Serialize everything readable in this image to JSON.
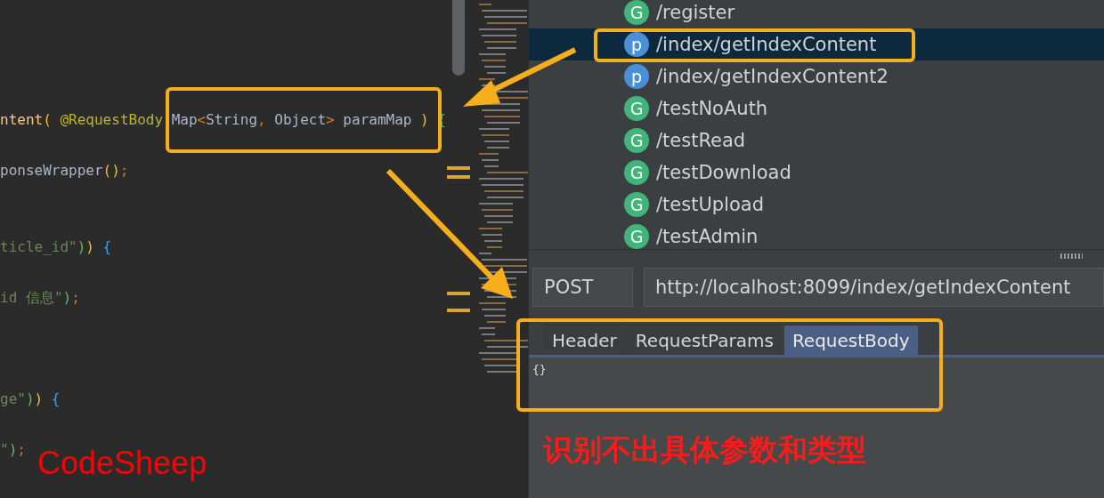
{
  "editor": {
    "lines": [
      {
        "kind": "blank"
      },
      {
        "kind": "blank"
      },
      {
        "kind": "blank"
      },
      {
        "kind": "blank"
      },
      {
        "kind": "code",
        "tokens": [
          {
            "t": "ntent",
            "kind": "method"
          },
          {
            "t": "(",
            "kind": "paren_yellow"
          },
          {
            "t": " @RequestBody ",
            "kind": "annotation"
          },
          {
            "t": "Map",
            "kind": "plain"
          },
          {
            "t": "<",
            "kind": "operator"
          },
          {
            "t": "String",
            "kind": "plain"
          },
          {
            "t": ",",
            "kind": "operator"
          },
          {
            "t": " Object",
            "kind": "plain"
          },
          {
            "t": ">",
            "kind": "operator"
          },
          {
            "t": " paramMap ",
            "kind": "plain"
          },
          {
            "t": ")",
            "kind": "paren_yellow"
          },
          {
            "t": " {",
            "kind": "brace_green"
          }
        ]
      },
      {
        "kind": "blank"
      },
      {
        "kind": "code",
        "tokens": [
          {
            "t": "ponseWrapper",
            "kind": "plain"
          },
          {
            "t": "()",
            "kind": "paren_yellow"
          },
          {
            "t": ";",
            "kind": "operator"
          }
        ]
      },
      {
        "kind": "blank"
      },
      {
        "kind": "blank"
      },
      {
        "kind": "code",
        "tokens": [
          {
            "t": "ticle_id\"",
            "kind": "string"
          },
          {
            "t": ")",
            "kind": "paren_green"
          },
          {
            "t": ")",
            "kind": "paren_yellow"
          },
          {
            "t": " {",
            "kind": "brace_blue"
          }
        ]
      },
      {
        "kind": "blank"
      },
      {
        "kind": "code",
        "tokens": [
          {
            "t": "id 信息\"",
            "kind": "string"
          },
          {
            "t": ")",
            "kind": "paren_green"
          },
          {
            "t": ";",
            "kind": "operator"
          }
        ]
      },
      {
        "kind": "blank"
      },
      {
        "kind": "blank"
      },
      {
        "kind": "blank"
      },
      {
        "kind": "code",
        "tokens": [
          {
            "t": "ge\"",
            "kind": "string"
          },
          {
            "t": ")",
            "kind": "paren_green"
          },
          {
            "t": ")",
            "kind": "paren_yellow"
          },
          {
            "t": " {",
            "kind": "brace_blue"
          }
        ]
      },
      {
        "kind": "blank"
      },
      {
        "kind": "code",
        "tokens": [
          {
            "t": "\"",
            "kind": "string"
          },
          {
            "t": ")",
            "kind": "paren_green"
          },
          {
            "t": ";",
            "kind": "operator"
          }
        ]
      }
    ]
  },
  "endpoints": [
    {
      "kind": "get",
      "icon": "G",
      "path": "/register",
      "selected": false
    },
    {
      "kind": "post",
      "icon": "p",
      "path": "/index/getIndexContent",
      "selected": true
    },
    {
      "kind": "post",
      "icon": "p",
      "path": "/index/getIndexContent2",
      "selected": false
    },
    {
      "kind": "get",
      "icon": "G",
      "path": "/testNoAuth",
      "selected": false
    },
    {
      "kind": "get",
      "icon": "G",
      "path": "/testRead",
      "selected": false
    },
    {
      "kind": "get",
      "icon": "G",
      "path": "/testDownload",
      "selected": false
    },
    {
      "kind": "get",
      "icon": "G",
      "path": "/testUpload",
      "selected": false
    },
    {
      "kind": "get",
      "icon": "G",
      "path": "/testAdmin",
      "selected": false
    }
  ],
  "request": {
    "method": "POST",
    "url": "http://localhost:8099/index/getIndexContent",
    "tabs": [
      {
        "label": "Header",
        "selected": false
      },
      {
        "label": "RequestParams",
        "selected": false
      },
      {
        "label": "RequestBody",
        "selected": true
      }
    ],
    "body": "{}"
  },
  "annotations": {
    "note": "识别不出具体参数和类型",
    "signature": "CodeSheep"
  }
}
